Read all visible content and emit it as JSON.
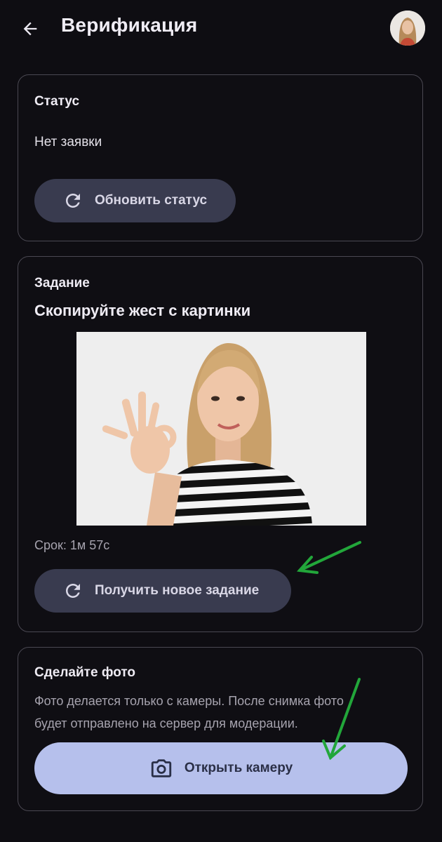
{
  "header": {
    "title": "Верификация",
    "icons": {
      "back": "arrow-left-icon",
      "avatar": "user-avatar"
    }
  },
  "status_card": {
    "heading": "Статус",
    "status_text": "Нет заявки",
    "refresh_button": {
      "label": "Обновить статус",
      "icon": "refresh-icon"
    }
  },
  "task_card": {
    "heading": "Задание",
    "title": "Скопируйте жест с картинки",
    "image": "woman-ok-gesture-photo",
    "deadline": "Срок: 1м 57с",
    "new_task_button": {
      "label": "Получить новое задание",
      "icon": "refresh-icon"
    }
  },
  "photo_card": {
    "heading": "Сделайте фото",
    "description_line1": "Фото делается только с камеры. После снимка фото",
    "description_line2": "будет отправлено на сервер для модерации.",
    "camera_button": {
      "label": "Открыть камеру",
      "icon": "camera-icon"
    }
  },
  "annotations": {
    "color": "#22a63a",
    "count": 2
  },
  "colors": {
    "background": "#0e0d12",
    "card_border": "#4a4852",
    "secondary_button": "#393b4f",
    "primary_button": "#b6c0ec",
    "primary_button_text": "#2a2f47"
  }
}
